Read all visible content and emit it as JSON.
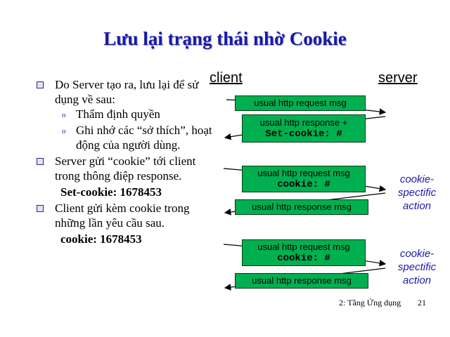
{
  "title": "Lưu lại trạng thái nhờ Cookie",
  "bullets": {
    "b1": "Do Server tạo ra, lưu lại để sử dụng về sau:",
    "b1_sub1": "Thẩm định quyền",
    "b1_sub2": "Ghi nhớ các “sở thích”, hoạt động của người dùng.",
    "b2": "Server gửi “cookie” tới client trong thông điệp response.",
    "b2_extra": "Set-cookie: 1678453",
    "b3": "Client gửi kèm cookie trong những lần yêu cầu sau.",
    "b3_extra": "cookie: 1678453"
  },
  "diagram": {
    "client_label": "client",
    "server_label": "server",
    "messages": [
      {
        "line1": "usual http request msg",
        "line2": ""
      },
      {
        "line1": "usual http response +",
        "line2": "Set-cookie: #"
      },
      {
        "line1": "usual http request msg",
        "line2": "cookie: #"
      },
      {
        "line1": "usual http response msg",
        "line2": ""
      },
      {
        "line1": "usual http request msg",
        "line2": "cookie: #"
      },
      {
        "line1": "usual http response msg",
        "line2": ""
      }
    ],
    "action1": "cookie-spectific action",
    "action2": "cookie-spectific action"
  },
  "footer": {
    "chapter": "2: Tầng Ứng dụng",
    "page": "21"
  },
  "colors": {
    "title": "#1a1aa6",
    "message_box": "#00b050",
    "action_text": "#1a1aa6"
  }
}
